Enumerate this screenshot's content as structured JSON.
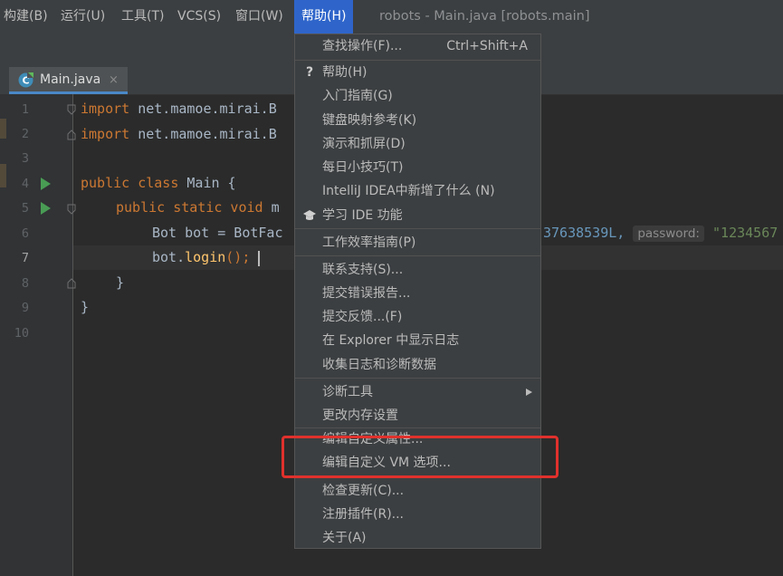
{
  "menubar": {
    "items": [
      "构建(B)",
      "运行(U)",
      "工具(T)",
      "VCS(S)",
      "窗口(W)",
      "帮助(H)"
    ],
    "window_title": "robots - Main.java [robots.main]"
  },
  "tab": {
    "name": "Main.java",
    "close": "×"
  },
  "editor": {
    "line_numbers": [
      "1",
      "2",
      "3",
      "4",
      "5",
      "6",
      "7",
      "8",
      "9",
      "10"
    ],
    "current_line": 7,
    "code": {
      "l1_kw": "import",
      "l1_rest": " net.mamoe.mirai.B",
      "l2_kw": "import",
      "l2_rest": " net.mamoe.mirai.B",
      "l4_kw": "public class",
      "l4_rest": " Main {",
      "l5_kw": "public static void",
      "l5_rest": " m",
      "l6_text": "Bot bot = BotFac",
      "l6_num": "37638539L,",
      "l6_hint": "password:",
      "l6_str": "\"1234567",
      "l7_obj": "bot.",
      "l7_fn": "login",
      "l7_rest": "();",
      "l8": "}",
      "l9": "}"
    }
  },
  "help_menu": {
    "items": [
      {
        "label": "查找操作(F)...",
        "shortcut": "Ctrl+Shift+A"
      },
      {
        "label": "帮助(H)",
        "icon": "?"
      },
      {
        "label": "入门指南(G)"
      },
      {
        "label": "键盘映射参考(K)"
      },
      {
        "label": "演示和抓屏(D)"
      },
      {
        "label": "每日小技巧(T)"
      },
      {
        "label": "IntelliJ IDEA中新增了什么 (N)"
      },
      {
        "label": "学习 IDE 功能"
      },
      {
        "label": "工作效率指南(P)"
      },
      {
        "label": "联系支持(S)..."
      },
      {
        "label": "提交错误报告..."
      },
      {
        "label": "提交反馈...(F)"
      },
      {
        "label": "在 Explorer 中显示日志"
      },
      {
        "label": "收集日志和诊断数据"
      },
      {
        "label": "诊断工具"
      },
      {
        "label": "更改内存设置"
      },
      {
        "label": "编辑自定义属性..."
      },
      {
        "label": "编辑自定义 VM 选项..."
      },
      {
        "label": "检查更新(C)..."
      },
      {
        "label": "注册插件(R)..."
      },
      {
        "label": "关于(A)"
      }
    ]
  },
  "colors": {
    "accent": "#2f65ca",
    "highlight_box": "#e0312c",
    "run_icon": "#499c54"
  }
}
